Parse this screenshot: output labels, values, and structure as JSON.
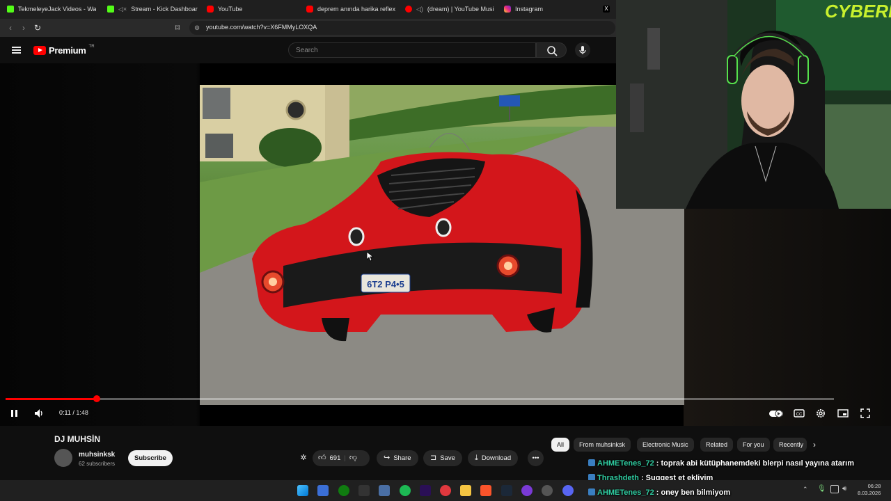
{
  "browser": {
    "tabs": [
      {
        "title": "TekmeleyeJack Videos - Watch",
        "icon": "kick-icon"
      },
      {
        "title": "Stream - Kick Dashboard",
        "icon": "kick-icon"
      },
      {
        "title": "YouTube",
        "icon": "youtube-icon"
      },
      {
        "title": "deprem anında harika reflex gö",
        "icon": "youtube-icon"
      },
      {
        "title": "(dream) | YouTube Music",
        "icon": "youtube-music-icon"
      },
      {
        "title": "Instagram",
        "icon": "instagram-icon"
      },
      {
        "title": "X",
        "icon": "x-icon"
      }
    ],
    "url": "youtube.com/watch?v=X6FMMyLOXQA"
  },
  "youtube": {
    "logo_word": "Premium",
    "logo_region": "TR",
    "search_placeholder": "Search"
  },
  "player": {
    "current_time": "0:11",
    "separator": " / ",
    "duration": "1:48",
    "progress_fraction": 0.11,
    "license_plate": "6T2 P4•5"
  },
  "video": {
    "title": "DJ MUHSİN",
    "channel": "muhsinksk",
    "subscribers": "62 subscribers",
    "subscribe_label": "Subscribe",
    "likes": "691",
    "share_label": "Share",
    "save_label": "Save",
    "download_label": "Download"
  },
  "chips": [
    "All",
    "From muhsinksk",
    "Electronic Music",
    "Related",
    "For you",
    "Recently"
  ],
  "chat": [
    {
      "user": "AHMETenes_72",
      "message": " : toprak abi kütüphanemdeki blerpi nasıl yayına atarım"
    },
    {
      "user": "Thrashdeth",
      "message": " : Suggest et ekliyim"
    },
    {
      "user": "AHMETenes_72",
      "message": " : oney ben bilmiyom"
    }
  ],
  "taskbar": {
    "time": "06:28",
    "date": "8.03.2026"
  },
  "colors": {
    "accent_red": "#ff0000",
    "chat_user": "#31d0a4",
    "kick_green": "#53fc18"
  }
}
